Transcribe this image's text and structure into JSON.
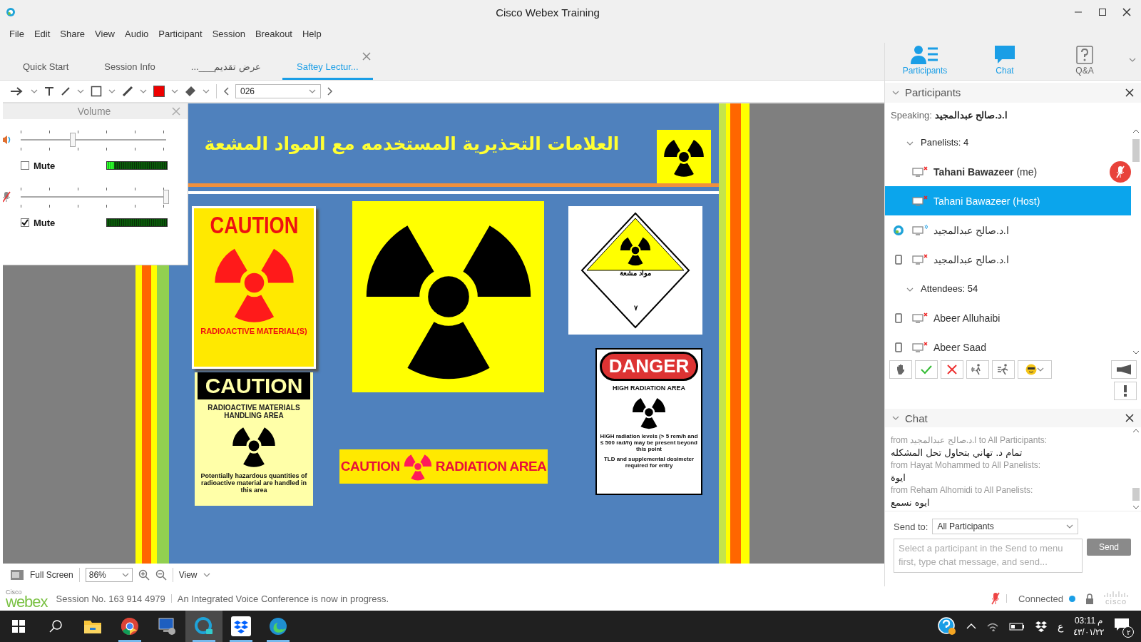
{
  "window": {
    "title": "Cisco Webex Training"
  },
  "menu": [
    "File",
    "Edit",
    "Share",
    "View",
    "Audio",
    "Participant",
    "Session",
    "Breakout",
    "Help"
  ],
  "tabs": [
    {
      "label": "Quick Start",
      "selected": false,
      "closable": false
    },
    {
      "label": "Session Info",
      "selected": false,
      "closable": false
    },
    {
      "label": "عرض تقديم___...",
      "selected": false,
      "closable": false
    },
    {
      "label": "Saftey Lectur...",
      "selected": true,
      "closable": true
    }
  ],
  "toolbar": {
    "page": "026"
  },
  "slide": {
    "title": "العلامات التحذيرية المستخدمه مع المواد المشعة",
    "signs": [
      {
        "kind": "poster",
        "lines": [
          "CAUTION",
          "RADIOACTIVE  MATERIAL(S)"
        ]
      },
      {
        "kind": "trefoil"
      },
      {
        "kind": "placard",
        "lines": [
          "مواد مشعة",
          "٧"
        ]
      },
      {
        "kind": "handling",
        "lines": [
          "CAUTION",
          "RADIOACTIVE MATERIALS HANDLING AREA",
          "Potentially hazardous quantities of radioactive material are handled in this area"
        ]
      },
      {
        "kind": "banner",
        "lines": [
          "CAUTION",
          "RADIATION AREA"
        ]
      },
      {
        "kind": "danger",
        "lines": [
          "DANGER",
          "HIGH RADIATION AREA",
          "HIGH radiation levels (> 5 rem/h and ≤ 500 rad/h) may be present beyond this point",
          "TLD and supplemental dosimeter required for entry"
        ]
      }
    ]
  },
  "volume": {
    "title": "Volume",
    "channels": [
      {
        "kind": "speaker",
        "slider": {
          "level": 0.36
        },
        "mute": {
          "label": "Mute",
          "checked": false
        },
        "meter": {
          "level": 0.12
        }
      },
      {
        "kind": "microphone",
        "slider": {
          "level": 1
        },
        "mute": {
          "label": "Mute",
          "checked": true
        },
        "meter": {
          "level": 0
        }
      }
    ]
  },
  "view_bar": {
    "full_screen": "Full Screen",
    "zoom": "86%",
    "view": "View"
  },
  "panel_tabs": [
    {
      "kind": "participants",
      "label": "Participants",
      "active": true
    },
    {
      "kind": "chat",
      "label": "Chat",
      "active": true
    },
    {
      "kind": "qa",
      "label": "Q&A",
      "active": false
    }
  ],
  "participants": {
    "title": "Participants",
    "speaking_label": "Speaking:",
    "speaking_name": "ا.د.صالح عبدالمجيد",
    "groups": [
      {
        "label": "Panelists: 4",
        "expanded": true,
        "members": [
          {
            "kind": "computer",
            "name": "**Tahani Bawazeer** (me)",
            "selected": false,
            "mic_muted": true,
            "mute_badge": true
          },
          {
            "kind": "computer",
            "name": "Tahani Bawazeer (Host)",
            "selected": true,
            "mic_muted": true,
            "mute_badge": false
          },
          {
            "kind": "webex",
            "name": "ا.د.صالح عبدالمجيد",
            "selected": false,
            "mic_muted": false,
            "mute_badge": false
          },
          {
            "kind": "phone",
            "name": "ا.د.صالح عبدالمجيد",
            "selected": false,
            "mic_muted": true,
            "mute_badge": false
          }
        ]
      },
      {
        "label": "Attendees: 54",
        "expanded": true,
        "members": [
          {
            "kind": "phone",
            "name": "Abeer Alluhaibi",
            "selected": false,
            "mic_muted": true,
            "mute_badge": false
          },
          {
            "kind": "phone",
            "name": "Abeer Saad",
            "selected": false,
            "mic_muted": true,
            "mute_badge": false
          }
        ]
      }
    ]
  },
  "chat": {
    "title": "Chat",
    "messages": [
      {
        "from": "from ا.د.صالح عبدالمجيد to All Participants:",
        "text": "تمام د. تهاني بتحاول تحل المشكله"
      },
      {
        "from": "from Hayat Mohammed to All Panelists:",
        "text": "ايوة"
      },
      {
        "from": "from Reham Alhomidi to All Panelists:",
        "text": "ايوه نسمع"
      }
    ],
    "send_to_label": "Send to:",
    "send_to": "All Participants",
    "placeholder": "Select a participant in the Send to menu first, type chat message, and send...",
    "send": "Send"
  },
  "status_bar": {
    "logo_small": "Cisco",
    "logo": "webex",
    "session": "Session No. 163 914 4979",
    "message": "An Integrated Voice Conference is now in progress.",
    "connection": "Connected",
    "vendor": "cisco"
  },
  "taskbar": {
    "apps": [
      {
        "kind": "explorer",
        "running": false,
        "active": false
      },
      {
        "kind": "chrome",
        "running": true,
        "active": false
      },
      {
        "kind": "remote",
        "running": false,
        "active": false
      },
      {
        "kind": "webex",
        "running": true,
        "active": true
      },
      {
        "kind": "dropbox",
        "running": true,
        "active": false
      },
      {
        "kind": "edge",
        "running": true,
        "active": false
      }
    ],
    "input_language": "ع",
    "time": "03:11 م",
    "date": "٤٣/٠١/٢٢",
    "notifications": "٢"
  }
}
